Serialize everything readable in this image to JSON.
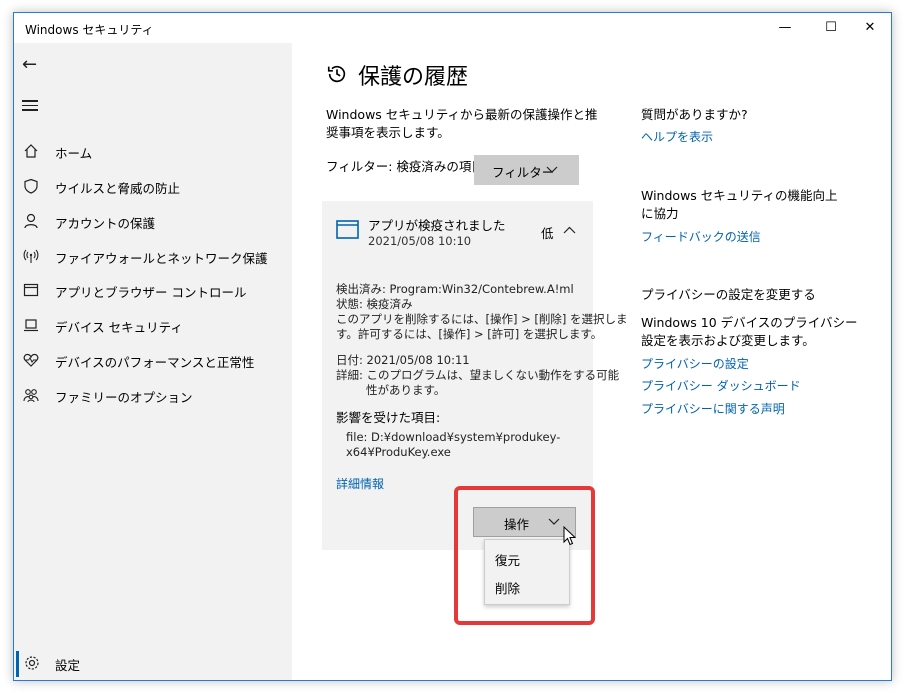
{
  "window": {
    "title": "Windows セキュリティ",
    "minimize": "—",
    "maximize": "☐",
    "close": "✕"
  },
  "sidebar": {
    "back": "←",
    "items": [
      {
        "label": "ホーム",
        "icon": "home-icon"
      },
      {
        "label": "ウイルスと脅威の防止",
        "icon": "shield-icon"
      },
      {
        "label": "アカウントの保護",
        "icon": "person-icon"
      },
      {
        "label": "ファイアウォールとネットワーク保護",
        "icon": "antenna-icon"
      },
      {
        "label": "アプリとブラウザー コントロール",
        "icon": "browser-icon"
      },
      {
        "label": "デバイス セキュリティ",
        "icon": "laptop-icon"
      },
      {
        "label": "デバイスのパフォーマンスと正常性",
        "icon": "heart-icon"
      },
      {
        "label": "ファミリーのオプション",
        "icon": "family-icon"
      }
    ],
    "settings_label": "設定"
  },
  "main": {
    "title": "保護の履歴",
    "description": "Windows セキュリティから最新の保護操作と推奨事項を表示します。",
    "filter_label": "フィルター: 検疫済みの項目",
    "filter_button": "フィルター",
    "card": {
      "title": "アプリが検疫されました",
      "timestamp": "2021/05/08 10:10",
      "severity": "低",
      "detected": "検出済み: Program:Win32/Contebrew.A!ml",
      "status": "状態: 検疫済み",
      "instr1": "このアプリを削除するには、[操作] > [削除] を選択しま",
      "instr2": "す。許可するには、[操作] > [許可] を選択します。",
      "date": "日付:   2021/05/08 10:11",
      "detail1": "詳細:   このプログラムは、望ましくない動作をする可能",
      "detail2": "性があります。",
      "affected_heading": "影響を受けた項目:",
      "file1": "file: D:¥download¥system¥produkey-",
      "file2": "x64¥ProduKey.exe",
      "more_link": "詳細情報",
      "action_button": "操作"
    },
    "dropdown": [
      "復元",
      "削除"
    ]
  },
  "right": {
    "q_heading": "質問がありますか?",
    "help_link": "ヘルプを表示",
    "improve_heading": "Windows セキュリティの機能向上に協力",
    "feedback_link": "フィードバックの送信",
    "privacy_heading": "プライバシーの設定を変更する",
    "privacy_desc": "Windows 10 デバイスのプライバシー設定を表示および変更します。",
    "privacy_links": [
      "プライバシーの設定",
      "プライバシー ダッシュボード",
      "プライバシーに関する声明"
    ]
  },
  "colors": {
    "accent": "#0063b1",
    "highlight": "#e53939",
    "sidebar_bg": "#f2f2f2"
  }
}
